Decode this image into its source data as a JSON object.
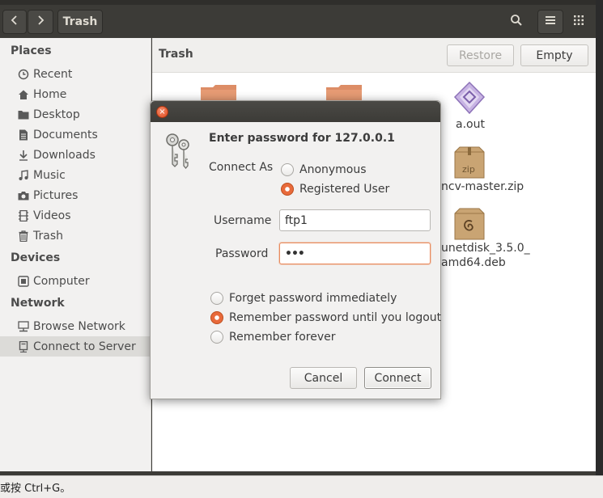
{
  "toolbar": {
    "location": "Trash"
  },
  "pathbar": {
    "title": "Trash",
    "restore_label": "Restore",
    "empty_label": "Empty"
  },
  "sidebar": {
    "places_header": "Places",
    "devices_header": "Devices",
    "network_header": "Network",
    "places": [
      {
        "label": "Recent",
        "icon": "clock-icon"
      },
      {
        "label": "Home",
        "icon": "home-icon"
      },
      {
        "label": "Desktop",
        "icon": "folder-icon"
      },
      {
        "label": "Documents",
        "icon": "document-icon"
      },
      {
        "label": "Downloads",
        "icon": "download-icon"
      },
      {
        "label": "Music",
        "icon": "music-icon"
      },
      {
        "label": "Pictures",
        "icon": "camera-icon"
      },
      {
        "label": "Videos",
        "icon": "film-icon"
      },
      {
        "label": "Trash",
        "icon": "trash-icon"
      }
    ],
    "devices": [
      {
        "label": "Computer",
        "icon": "drive-icon"
      }
    ],
    "network": [
      {
        "label": "Browse Network",
        "icon": "network-icon"
      },
      {
        "label": "Connect to Server",
        "icon": "server-icon"
      }
    ]
  },
  "files": [
    {
      "label": "a.out",
      "icon": "executable-icon"
    },
    {
      "label": "ncv-master.zip",
      "icon": "zip-archive-icon",
      "badge": "zip"
    },
    {
      "label_line1": "unetdisk_3.5.0_",
      "label_line2": "amd64.deb",
      "icon": "debian-package-icon"
    }
  ],
  "dialog": {
    "heading": "Enter password for 127.0.0.1",
    "connect_as_label": "Connect As",
    "options": {
      "anonymous": "Anonymous",
      "registered": "Registered User",
      "selected": "Registered User"
    },
    "username_label": "Username",
    "username_value": "ftp1",
    "password_label": "Password",
    "password_value": "•••",
    "remember": {
      "forget": "Forget password immediately",
      "until_logout": "Remember password until you logout",
      "forever": "Remember forever",
      "selected": "Remember password until you logout"
    },
    "cancel_label": "Cancel",
    "connect_label": "Connect"
  },
  "statusbar": {
    "text": "或按 Ctrl+G。"
  },
  "colors": {
    "accent": "#e86a3b",
    "toolbar_bg": "#3c3b37",
    "sidebar_bg": "#f2f1f0"
  }
}
